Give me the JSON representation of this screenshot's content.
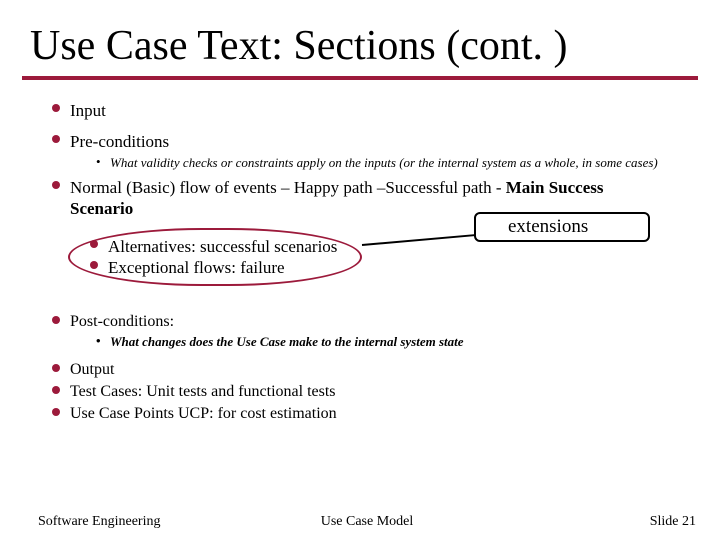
{
  "title": "Use Case Text: Sections (cont. )",
  "items": {
    "input": "Input",
    "preconditions": "Pre-conditions",
    "preconditions_sub": "What validity checks or constraints apply on the inputs (or the internal system as a whole, in some cases)",
    "normal_flow_prefix": "Normal (Basic) flow of events – Happy path –Successful path - ",
    "normal_flow_bold": "Main Success Scenario",
    "alt": "Alternatives: successful scenarios",
    "exc": "Exceptional  flows: failure",
    "extensions_label": "extensions",
    "post": "Post-conditions:",
    "post_sub": "What changes does the Use Case make to the internal system state",
    "output": "Output",
    "tests": "Test Cases: Unit tests and functional tests",
    "ucp": "Use Case Points UCP: for cost estimation"
  },
  "footer": {
    "left": "Software Engineering",
    "center": "Use Case Model",
    "right_prefix": "Slide  ",
    "slide_number": "21"
  }
}
